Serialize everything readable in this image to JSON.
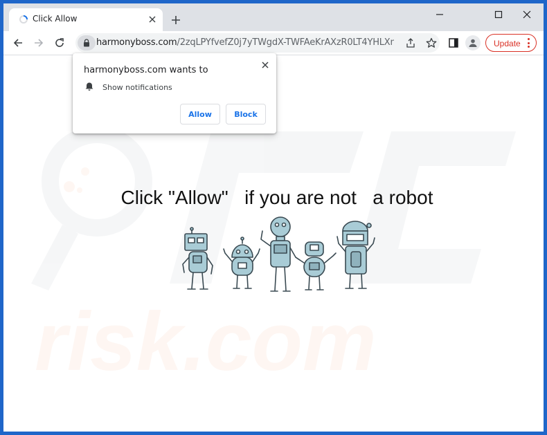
{
  "tab": {
    "title": "Click Allow",
    "favicon_icon": "loading-spinner-icon",
    "close_icon": "close-icon"
  },
  "new_tab_icon": "plus-icon",
  "window_controls": [
    "minimize-icon",
    "maximize-icon",
    "close-icon"
  ],
  "toolbar": {
    "url_host": "harmonyboss.com",
    "url_path": "/2zqLPYfvefZ0j7yTWgdX-TWFAeKrAXzR0LT4YHLXmbU/?...",
    "update_label": "Update",
    "update_color": "#d93025"
  },
  "prompt": {
    "title": "harmonyboss.com wants to",
    "permission": "Show notifications",
    "allow_label": "Allow",
    "block_label": "Block",
    "accent": "#1a73e8"
  },
  "page": {
    "headline": "Click \"Allow\"   if you are not   a robot",
    "illustration": "five-cartoon-robots"
  },
  "colors": {
    "titlebar": "#dee1e6",
    "frame": "#1f66c9",
    "robot_fill": "#a9ccd6"
  }
}
